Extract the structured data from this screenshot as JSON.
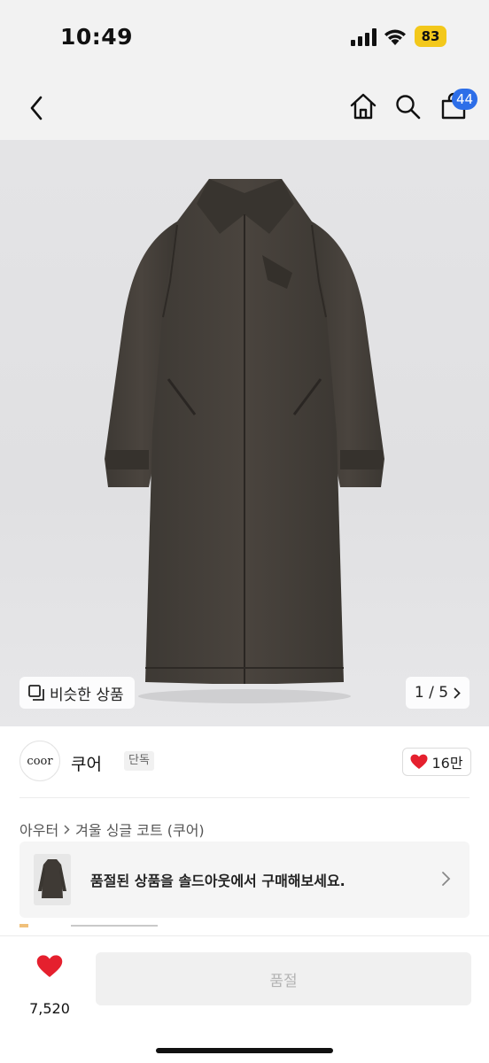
{
  "status_bar": {
    "time": "10:49",
    "battery": "83"
  },
  "nav": {
    "cart_count": "44"
  },
  "hero": {
    "similar_label": "비슷한 상품",
    "page_counter": "1 / 5"
  },
  "brand": {
    "logo_text": "coor",
    "name": "쿠어",
    "tag": "단독",
    "likes": "16만"
  },
  "breadcrumb": {
    "category": "아우터",
    "product": "겨울 싱글 코트 (쿠어)"
  },
  "banner": {
    "text": "품절된 상품을 솔드아웃에서 구매해보세요."
  },
  "bottom": {
    "wish_count": "7,520",
    "buy_label": "품절"
  },
  "colors": {
    "accent_blue": "#2d6ee8",
    "heart_red": "#e5202e",
    "battery_yellow": "#f3c81b",
    "coat": "#45403b"
  }
}
